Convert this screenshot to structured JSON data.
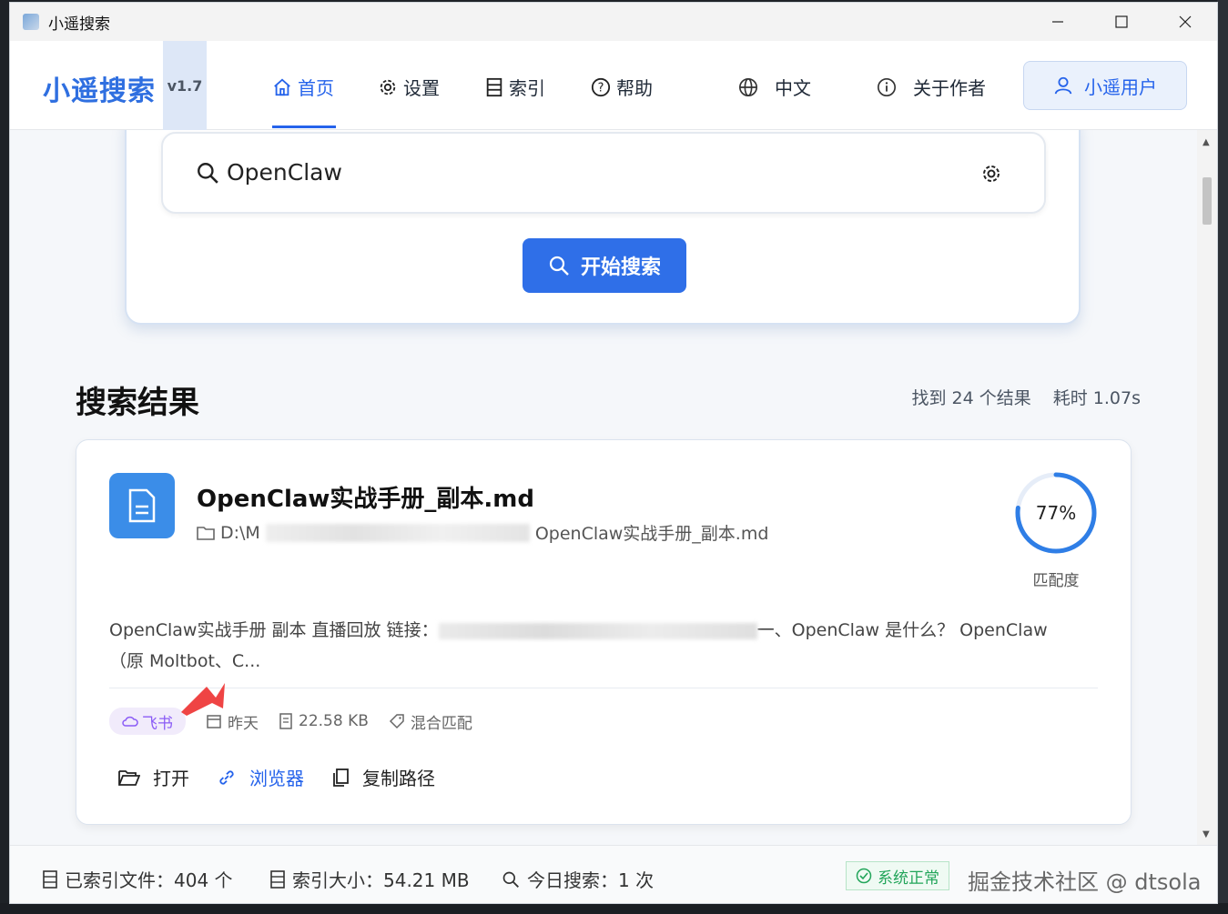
{
  "window": {
    "title": "小遥搜索"
  },
  "nav": {
    "brand": "小遥搜索",
    "version": "v1.7",
    "items": [
      {
        "label": "首页",
        "icon": "home-icon"
      },
      {
        "label": "设置",
        "icon": "gear-icon"
      },
      {
        "label": "索引",
        "icon": "index-icon"
      },
      {
        "label": "帮助",
        "icon": "help-icon"
      },
      {
        "label": "中文",
        "icon": "globe-icon"
      },
      {
        "label": "关于作者",
        "icon": "info-icon"
      }
    ],
    "user": "小遥用户"
  },
  "search": {
    "query": "OpenClaw",
    "button": "开始搜索"
  },
  "results": {
    "title": "搜索结果",
    "found": "找到 24 个结果",
    "time": "耗时 1.07s",
    "items": [
      {
        "name": "OpenClaw实战手册_副本.md",
        "path_prefix": "D:\\M",
        "path_suffix": "OpenClaw实战手册_副本.md",
        "match_pct": "77%",
        "match_value": 0.77,
        "match_label": "匹配度",
        "snippet_a": "OpenClaw实战手册 副本 直播回放 链接：",
        "snippet_b": "一、OpenClaw 是什么？ OpenClaw",
        "snippet_c": "（原 Moltbot、C...",
        "tag": "飞书",
        "date": "昨天",
        "size": "22.58 KB",
        "match_type": "混合匹配",
        "actions": {
          "open": "打开",
          "browser": "浏览器",
          "copy": "复制路径"
        }
      }
    ]
  },
  "status": {
    "indexed_files": "已索引文件：404 个",
    "index_size": "索引大小：54.21 MB",
    "today_search": "今日搜索：1 次",
    "system": "系统正常",
    "watermark": "掘金技术社区 @ dtsola"
  },
  "colors": {
    "accent": "#2563eb",
    "tag": "#8b5cf6",
    "ok": "#22a55a"
  }
}
